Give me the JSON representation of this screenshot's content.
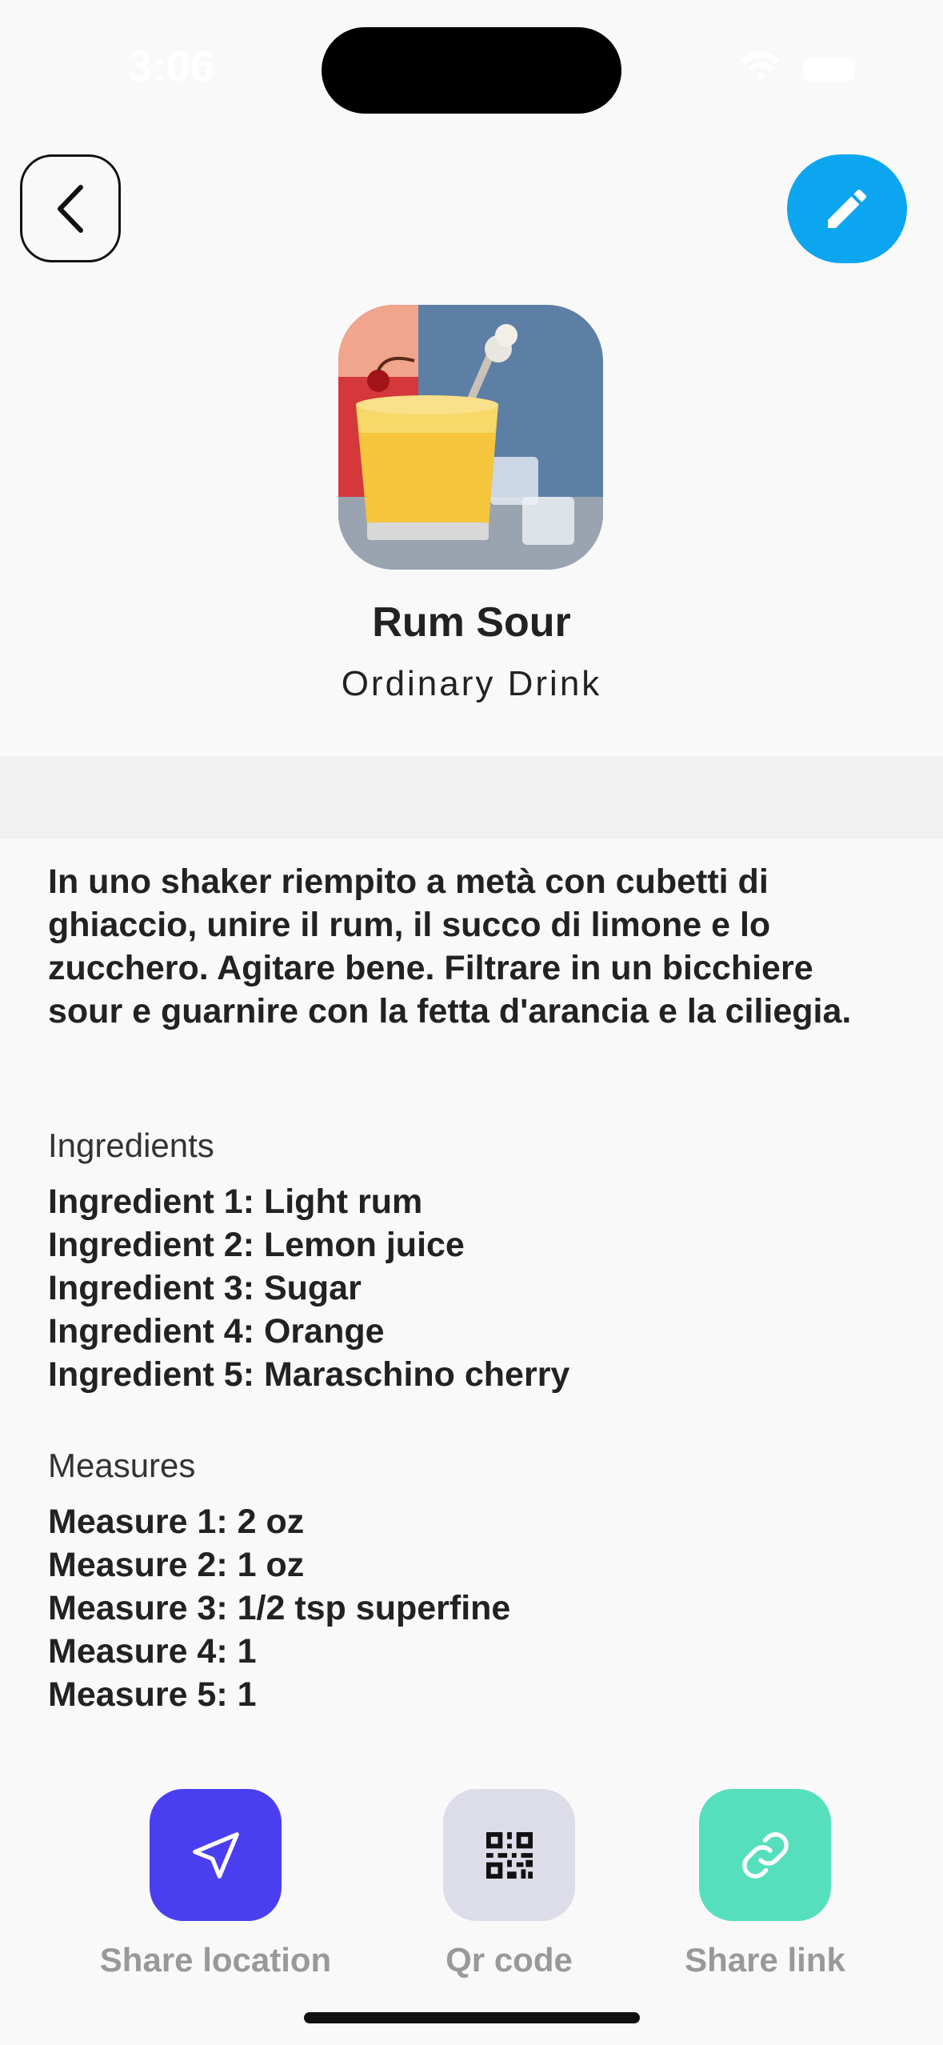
{
  "status_bar": {
    "time": "3:06"
  },
  "header": {
    "back_icon": "chevron-left-icon",
    "edit_icon": "pencil-icon",
    "accent": "#0ba6ef"
  },
  "drink": {
    "name": "Rum Sour",
    "category": "Ordinary Drink",
    "instructions": "In uno shaker riempito a metà con cubetti di ghiaccio, unire il rum, il succo di limone e lo zucchero. Agitare bene. Filtrare in un bicchiere sour e guarnire con la fetta d'arancia e la ciliegia."
  },
  "ingredients": {
    "label": "Ingredients",
    "items": [
      "Ingredient 1: Light rum",
      "Ingredient 2: Lemon juice",
      "Ingredient 3: Sugar",
      "Ingredient 4: Orange",
      "Ingredient 5: Maraschino cherry"
    ]
  },
  "measures": {
    "label": "Measures",
    "items": [
      "Measure 1: 2 oz",
      "Measure 2: 1 oz",
      "Measure 3: 1/2 tsp superfine",
      "Measure 4: 1",
      "Measure 5: 1"
    ]
  },
  "actions": [
    {
      "label": "Share location",
      "icon": "navigation-arrow-icon",
      "color": "#4a3ff0"
    },
    {
      "label": "Qr code",
      "icon": "qr-code-icon",
      "color": "#dcdde8"
    },
    {
      "label": "Share link",
      "icon": "link-icon",
      "color": "#55dfbd"
    }
  ]
}
